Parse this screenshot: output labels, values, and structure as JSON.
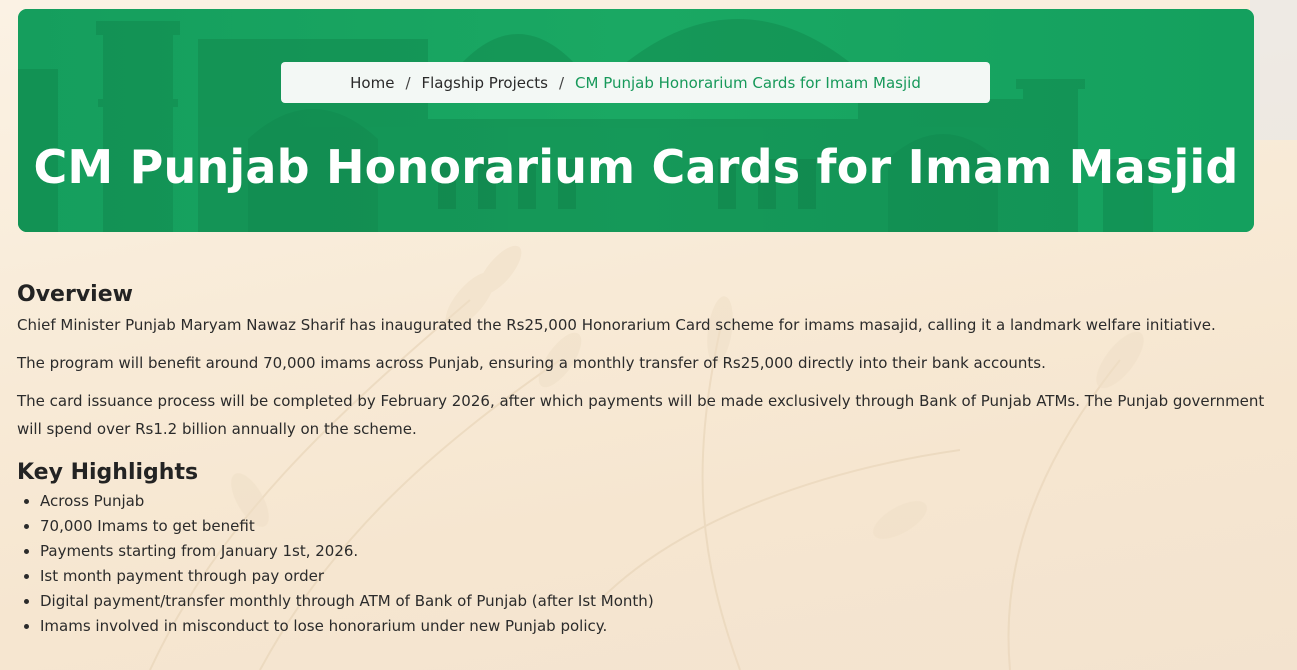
{
  "breadcrumb": {
    "home": "Home",
    "separator": "/",
    "section": "Flagship Projects",
    "current": "CM Punjab Honorarium Cards for Imam Masjid"
  },
  "hero": {
    "title": "CM Punjab Honorarium Cards for Imam Masjid"
  },
  "overview": {
    "heading": "Overview",
    "paragraphs": [
      "Chief Minister Punjab Maryam Nawaz Sharif has inaugurated the Rs25,000 Honorarium Card scheme for imams masajid, calling it a landmark welfare initiative.",
      "The program will benefit around 70,000 imams across Punjab, ensuring a monthly transfer of Rs25,000 directly into their bank accounts.",
      "The card issuance process will be completed by February 2026, after which payments will be made exclusively through Bank of Punjab ATMs. The Punjab government will spend over Rs1.2 billion annually on the scheme."
    ]
  },
  "highlights": {
    "heading": "Key Highlights",
    "items": [
      "Across Punjab",
      "70,000 Imams to get benefit",
      "Payments starting from January 1st, 2026.",
      "Ist month payment through pay order",
      "Digital payment/transfer monthly through ATM of Bank of Punjab (after Ist Month)",
      "Imams involved in misconduct to lose honorarium under new Punjab policy."
    ]
  },
  "colors": {
    "hero_green": "#16a461",
    "breadcrumb_active": "#17995a",
    "page_background": "#f8ead6"
  }
}
